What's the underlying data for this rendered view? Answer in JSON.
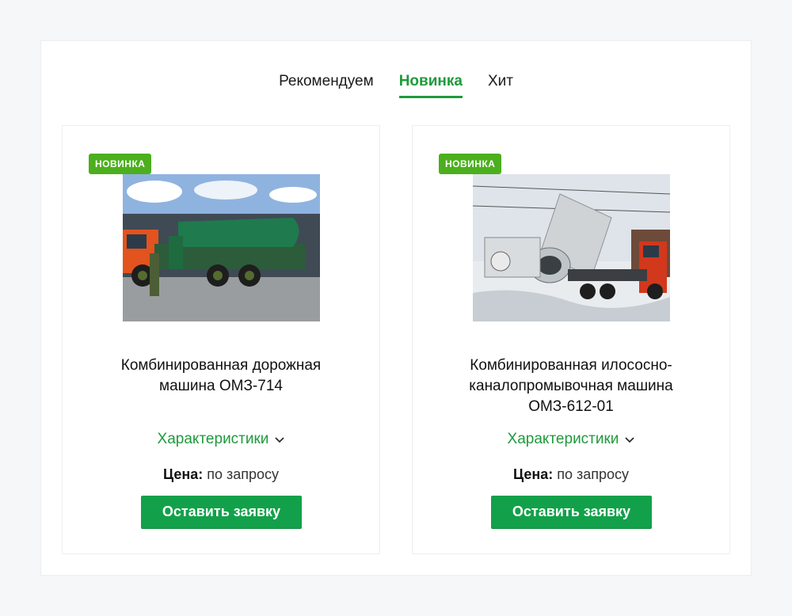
{
  "tabs": [
    {
      "label": "Рекомендуем",
      "active": false
    },
    {
      "label": "Новинка",
      "active": true
    },
    {
      "label": "Хит",
      "active": false
    }
  ],
  "products": [
    {
      "badge": "НОВИНКА",
      "title_line1": "Комбинированная дорожная",
      "title_line2": "машина ОМЗ-714",
      "title_line3": "",
      "specs_label": "Характеристики",
      "price_label": "Цена:",
      "price_value": "по запросу",
      "button_label": "Оставить заявку"
    },
    {
      "badge": "НОВИНКА",
      "title_line1": "Комбинированная илососно-",
      "title_line2": "каналопромывочная машина",
      "title_line3": "ОМЗ-612-01",
      "specs_label": "Характеристики",
      "price_label": "Цена:",
      "price_value": "по запросу",
      "button_label": "Оставить заявку"
    }
  ],
  "colors": {
    "accent": "#1f9a3c",
    "button": "#12a14a",
    "badge": "#4caf1e"
  }
}
